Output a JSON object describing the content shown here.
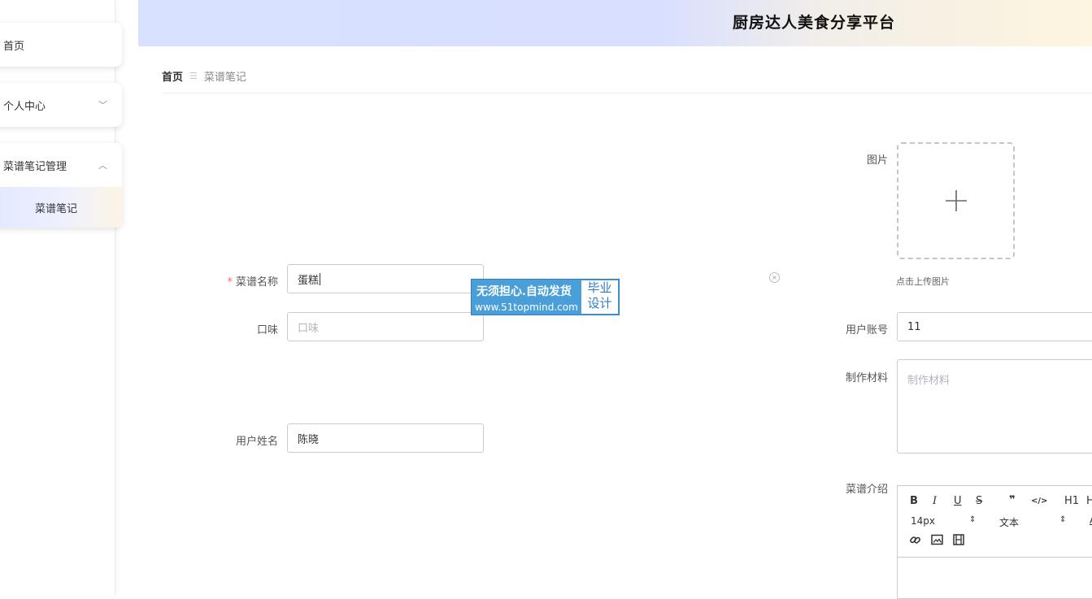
{
  "app": {
    "title": "厨房达人美食分享平台"
  },
  "sidebar": {
    "items": [
      {
        "label": "首页"
      },
      {
        "label": "个人中心",
        "chevron": "﹀"
      },
      {
        "label": "菜谱笔记管理",
        "chevron": "︿",
        "children": [
          {
            "label": "菜谱笔记"
          }
        ]
      }
    ]
  },
  "breadcrumb": {
    "home": "首页",
    "separator": "☰",
    "current": "菜谱笔记"
  },
  "form": {
    "recipe_name": {
      "label": "菜谱名称",
      "value": "蛋糕"
    },
    "taste": {
      "label": "口味",
      "placeholder": "口味"
    },
    "user_name": {
      "label": "用户姓名",
      "value": "陈晓"
    },
    "image": {
      "label": "图片",
      "hint": "点击上传图片"
    },
    "user_account": {
      "label": "用户账号",
      "value": "11"
    },
    "materials": {
      "label": "制作材料",
      "placeholder": "制作材料"
    },
    "intro": {
      "label": "菜谱介绍"
    }
  },
  "editor": {
    "bold": "B",
    "italic": "I",
    "underline": "U",
    "strike": "S",
    "quote": "❞",
    "code": "</>",
    "h1": "H1",
    "h2": "H",
    "font_size": "14px",
    "text_type": "文本",
    "select_arrow": "⇕",
    "color": "A"
  },
  "watermark": {
    "line1": "无须担心.自动发货",
    "line2": "www.51topmind.com",
    "badge_line1": "毕业",
    "badge_line2": "设计"
  },
  "colors": {
    "header_start": "#d8e1ff",
    "header_end": "#fdf5df",
    "required": "#f56c6c",
    "watermark": "#4a9fd8"
  }
}
